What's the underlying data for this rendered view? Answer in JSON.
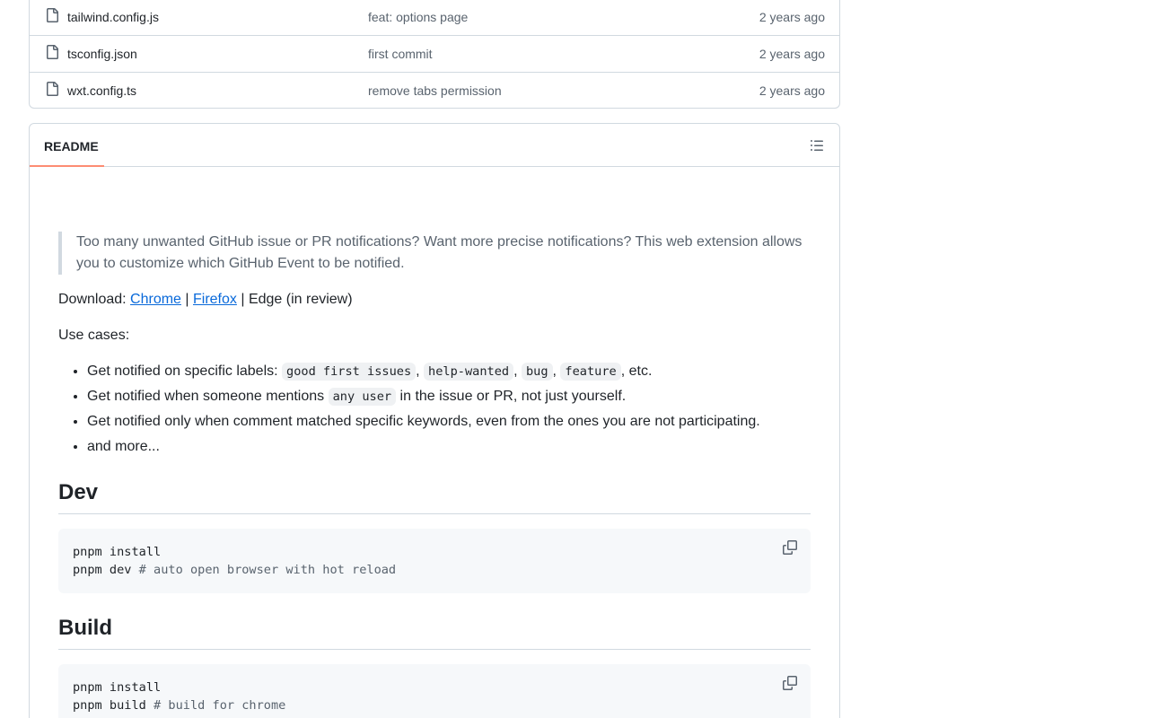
{
  "files": [
    {
      "name": "tailwind.config.js",
      "message": "feat: options page",
      "date": "2 years ago"
    },
    {
      "name": "tsconfig.json",
      "message": "first commit",
      "date": "2 years ago"
    },
    {
      "name": "wxt.config.ts",
      "message": "remove tabs permission",
      "date": "2 years ago"
    }
  ],
  "readme": {
    "tab_label": "README",
    "outline_icon": "list-unordered-icon",
    "quote": "Too many unwanted GitHub issue or PR notifications? Want more precise notifications? This web extension allows you to customize which GitHub Event to be notified.",
    "download": {
      "prefix": "Download: ",
      "chrome": "Chrome",
      "sep1": " | ",
      "firefox": "Firefox",
      "suffix": " | Edge (in review)"
    },
    "use_cases_label": "Use cases:",
    "use_cases": {
      "item1_text": "Get notified on specific labels: ",
      "item1_codes": [
        "good first issues",
        "help-wanted",
        "bug",
        "feature"
      ],
      "item1_sep": ", ",
      "item1_end": ", etc.",
      "item2_prefix": "Get notified when someone mentions ",
      "item2_code": "any user",
      "item2_suffix": " in the issue or PR, not just yourself.",
      "item3": "Get notified only when comment matched specific keywords, even from the ones you are not participating.",
      "item4": "and more..."
    },
    "dev": {
      "heading": "Dev",
      "line1": "pnpm install",
      "line2_cmd": "pnpm dev ",
      "line2_comment": "# auto open browser with hot reload"
    },
    "build": {
      "heading": "Build",
      "line1": "pnpm install",
      "line2_cmd": "pnpm build ",
      "line2_comment": "# build for chrome"
    }
  },
  "colors": {
    "link": "#0969da",
    "tab_underline": "#fd8c73",
    "border": "#d1d9e0",
    "muted": "#59636e"
  }
}
